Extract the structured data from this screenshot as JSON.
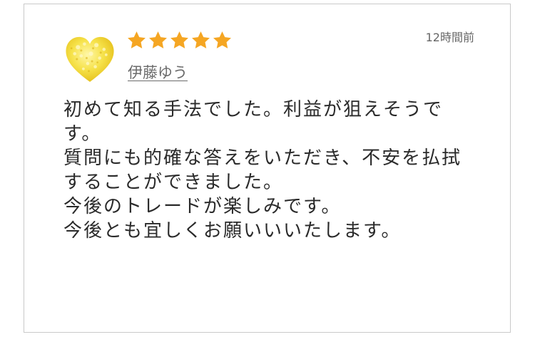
{
  "review": {
    "rating": 5,
    "rating_max": 5,
    "star_color": "#f5a623",
    "avatar_icon": "yellow-flower-heart",
    "reviewer_name": "伊藤ゆう",
    "timestamp": "12時間前",
    "lines": [
      "初めて知る手法でした。利益が狙えそうで",
      "す。",
      "質問にも的確な答えをいただき、不安を払拭",
      "することができました。",
      "今後のトレードが楽しみです。",
      "今後とも宜しくお願いいいたします。"
    ]
  }
}
